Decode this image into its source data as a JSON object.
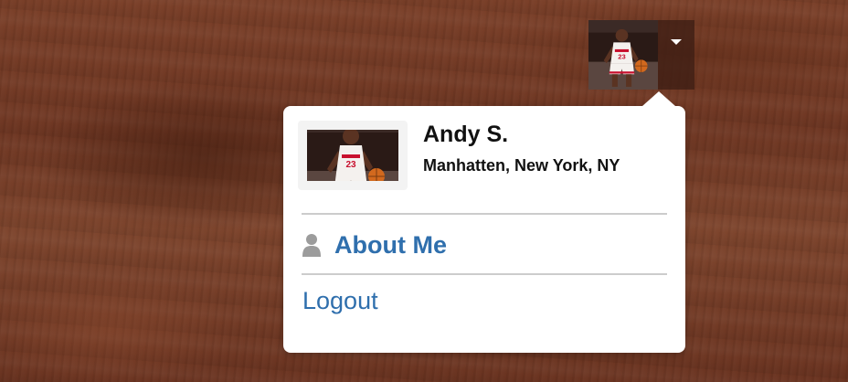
{
  "user_toggle": {
    "avatar_icon": "basketball-player-photo",
    "caret_icon": "caret-down-icon"
  },
  "dropdown": {
    "profile": {
      "name": "Andy S.",
      "location": "Manhatten, New York, NY"
    },
    "menu": {
      "about_label": "About Me",
      "about_icon": "user-icon",
      "logout_label": "Logout"
    }
  },
  "colors": {
    "link": "#2f6fad",
    "text": "#111111",
    "divider": "#cccccc",
    "panel": "#ffffff"
  }
}
